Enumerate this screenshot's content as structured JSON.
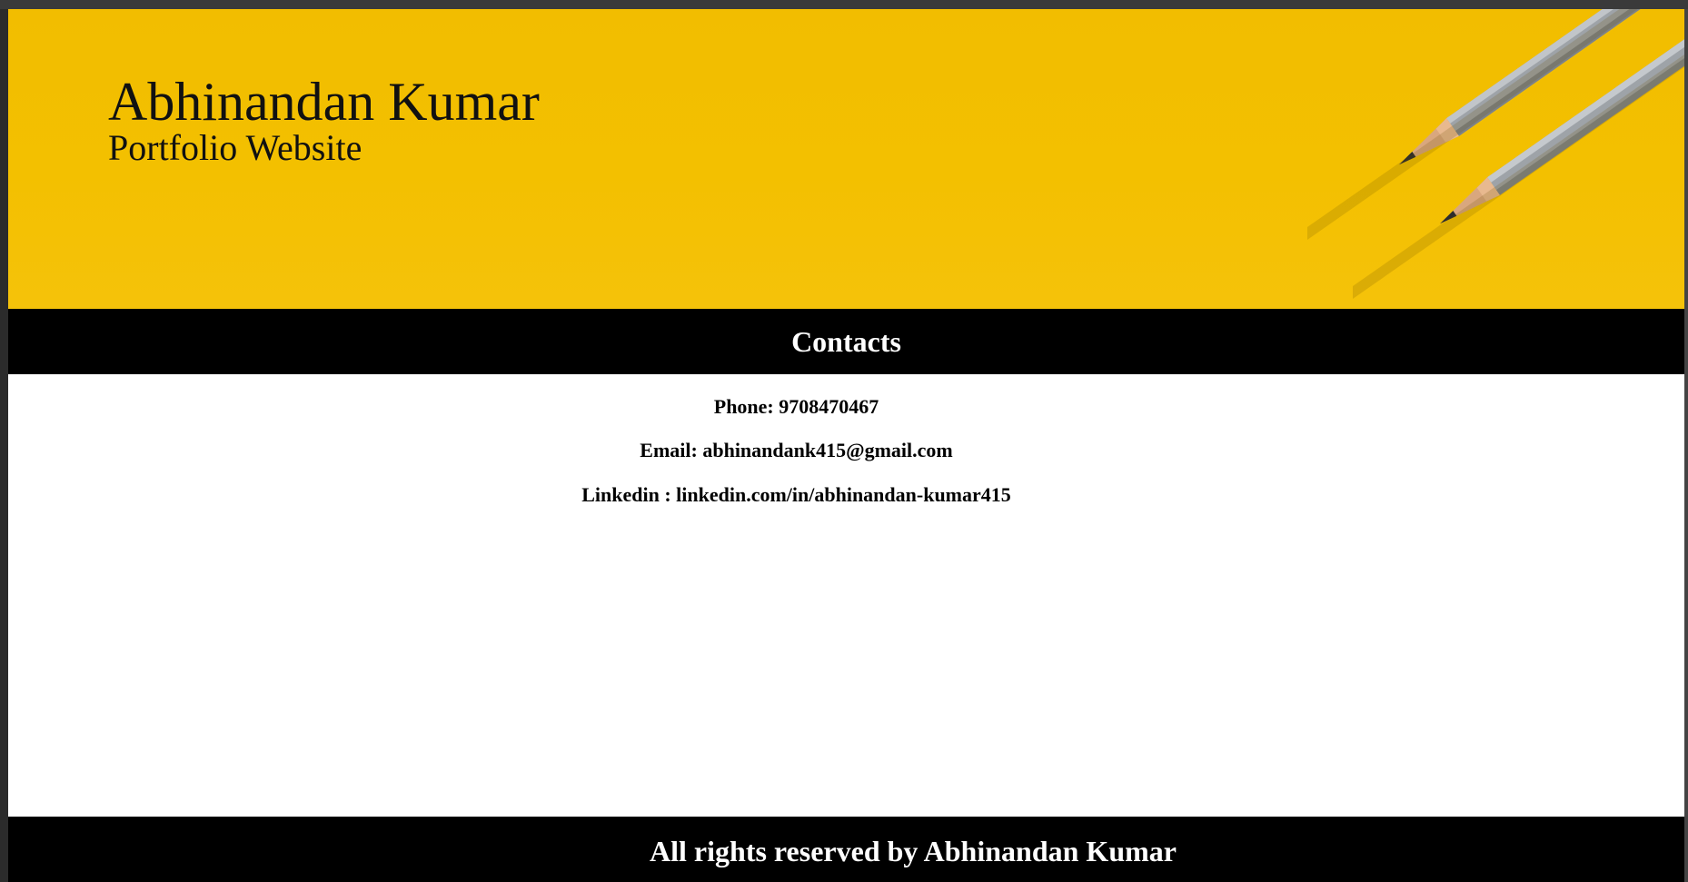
{
  "header": {
    "name": "Abhinandan Kumar",
    "subtitle": "Portfolio Website"
  },
  "contacts": {
    "heading": "Contacts",
    "phone_label": "Phone:",
    "phone_value": "9708470467",
    "email_label": "Email:",
    "email_value": "abhinandank415@gmail.com",
    "linkedin_label": "Linkedin :",
    "linkedin_value": "linkedin.com/in/abhinandan-kumar415"
  },
  "footer": {
    "text": "All rights reserved by Abhinandan Kumar"
  },
  "colors": {
    "banner": "#f2bd00",
    "bars": "#000000",
    "text_light": "#ffffff",
    "text_dark": "#000000"
  },
  "images": {
    "banner_decoration": "pencils-image"
  }
}
